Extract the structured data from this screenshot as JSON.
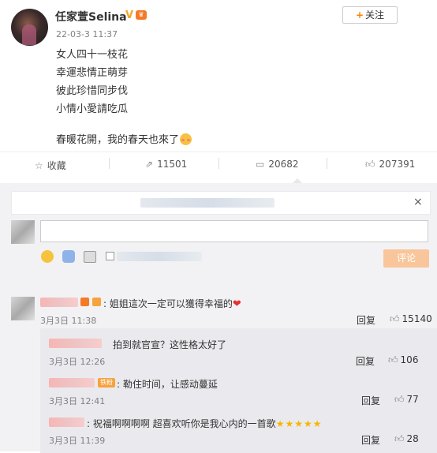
{
  "post": {
    "author": "任家萱Selina",
    "verified_badge": "V",
    "follow_label": "关注",
    "timestamp": "22-03-3 11:37",
    "lines": [
      "女人四十一枝花",
      "幸運悲情正萌芽",
      "彼此珍惜同步伐",
      "小情小愛請吃瓜"
    ],
    "closing_line": "春暖花開，我的春天也來了"
  },
  "actions": {
    "favorite_label": "收藏",
    "repost_count": "11501",
    "comment_count": "20682",
    "like_count": "207391"
  },
  "composer": {
    "close_glyph": "×",
    "submit_label": "评论"
  },
  "comments": [
    {
      "text": "姐姐這次一定可以獲得幸福的",
      "time": "3月3日 11:38",
      "reply_label": "回复",
      "likes": "15140",
      "replies": [
        {
          "text": "拍到就官宣？这性格太好了",
          "time": "3月3日 12:26",
          "reply_label": "回复",
          "likes": "106"
        },
        {
          "text": "铁粉",
          "body": ":  勒住时间，让感动蔓延",
          "time": "3月3日 12:41",
          "reply_label": "回复",
          "likes": "77"
        },
        {
          "text": ":  祝福啊啊啊啊  超喜欢听你是我心内的一首歌",
          "time": "3月3日 11:39",
          "reply_label": "回复",
          "likes": "28"
        }
      ]
    }
  ],
  "colors": {
    "accent": "#ff8200",
    "link": "#eb7350",
    "submit_disabled": "#f9c59b"
  }
}
